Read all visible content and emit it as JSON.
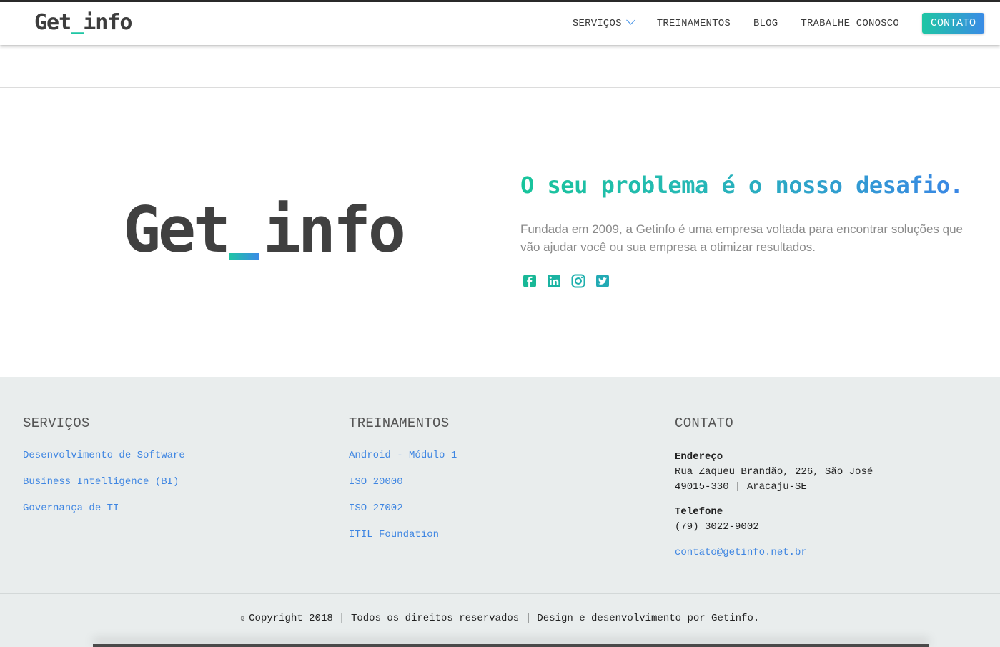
{
  "header": {
    "logo_left": "Get",
    "logo_underscore": "_",
    "logo_right": "info",
    "nav": [
      {
        "label": "SERVIÇOS"
      },
      {
        "label": "TREINAMENTOS"
      },
      {
        "label": "BLOG"
      },
      {
        "label": "TRABALHE CONOSCO"
      }
    ],
    "cta": "CONTATO"
  },
  "hero": {
    "logo_left": "Get",
    "logo_gap": " ",
    "logo_right": "info",
    "title": "O seu problema é o nosso desafio.",
    "description": "Fundada em 2009, a Getinfo é uma empresa voltada para encontrar soluções que vão ajudar você ou sua empresa a otimizar resultados.",
    "social_icons": [
      "facebook-icon",
      "linkedin-icon",
      "instagram-icon",
      "twitter-icon"
    ]
  },
  "footer": {
    "servicos": {
      "title": "SERVIÇOS",
      "links": [
        "Desenvolvimento de Software",
        "Business Intelligence (BI)",
        "Governança de TI"
      ]
    },
    "treinamentos": {
      "title": "TREINAMENTOS",
      "links": [
        "Android - Módulo 1",
        "ISO 20000",
        "ISO 27002",
        "ITIL Foundation"
      ]
    },
    "contato": {
      "title": "CONTATO",
      "address_label": "Endereço",
      "address_line1": "Rua Zaqueu Brandão, 226, São José",
      "address_line2": "49015-330 | Aracaju-SE",
      "phone_label": "Telefone",
      "phone": "(79) 3022-9002",
      "email": "contato@getinfo.net.br"
    },
    "copyright_symbol": "©",
    "copyright": "Copyright 2018 | Todos os direitos reservados | Design e desenvolvimento por Getinfo."
  },
  "colors": {
    "accent_green": "#1ec6a4",
    "accent_blue": "#3a8be6",
    "link_blue": "#3f86e2",
    "footer_bg": "#e9eded"
  }
}
